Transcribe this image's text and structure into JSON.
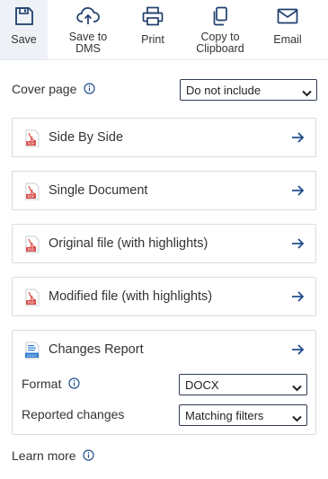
{
  "toolbar": {
    "save": "Save",
    "save_to_dms": "Save to\nDMS",
    "print": "Print",
    "copy_to_clipboard": "Copy to\nClipboard",
    "email": "Email"
  },
  "cover_page": {
    "label": "Cover page",
    "selected": "Do not include"
  },
  "exports": [
    {
      "label": "Side By Side",
      "icon": "pdf-icon"
    },
    {
      "label": "Single Document",
      "icon": "pdf-icon"
    },
    {
      "label": "Original file (with highlights)",
      "icon": "pdf-icon"
    },
    {
      "label": "Modified file (with highlights)",
      "icon": "pdf-icon"
    }
  ],
  "changes_report": {
    "label": "Changes Report",
    "icon": "docx-icon",
    "icon_text": "DOCX",
    "format_label": "Format",
    "format_value": "DOCX",
    "reported_label": "Reported changes",
    "reported_value": "Matching filters"
  },
  "learn_more": "Learn more",
  "colors": {
    "accent": "#1f4e8c",
    "pdf_red": "#d9534f",
    "border": "#d7dbe0",
    "active_tab_bg": "#eef1f6"
  }
}
